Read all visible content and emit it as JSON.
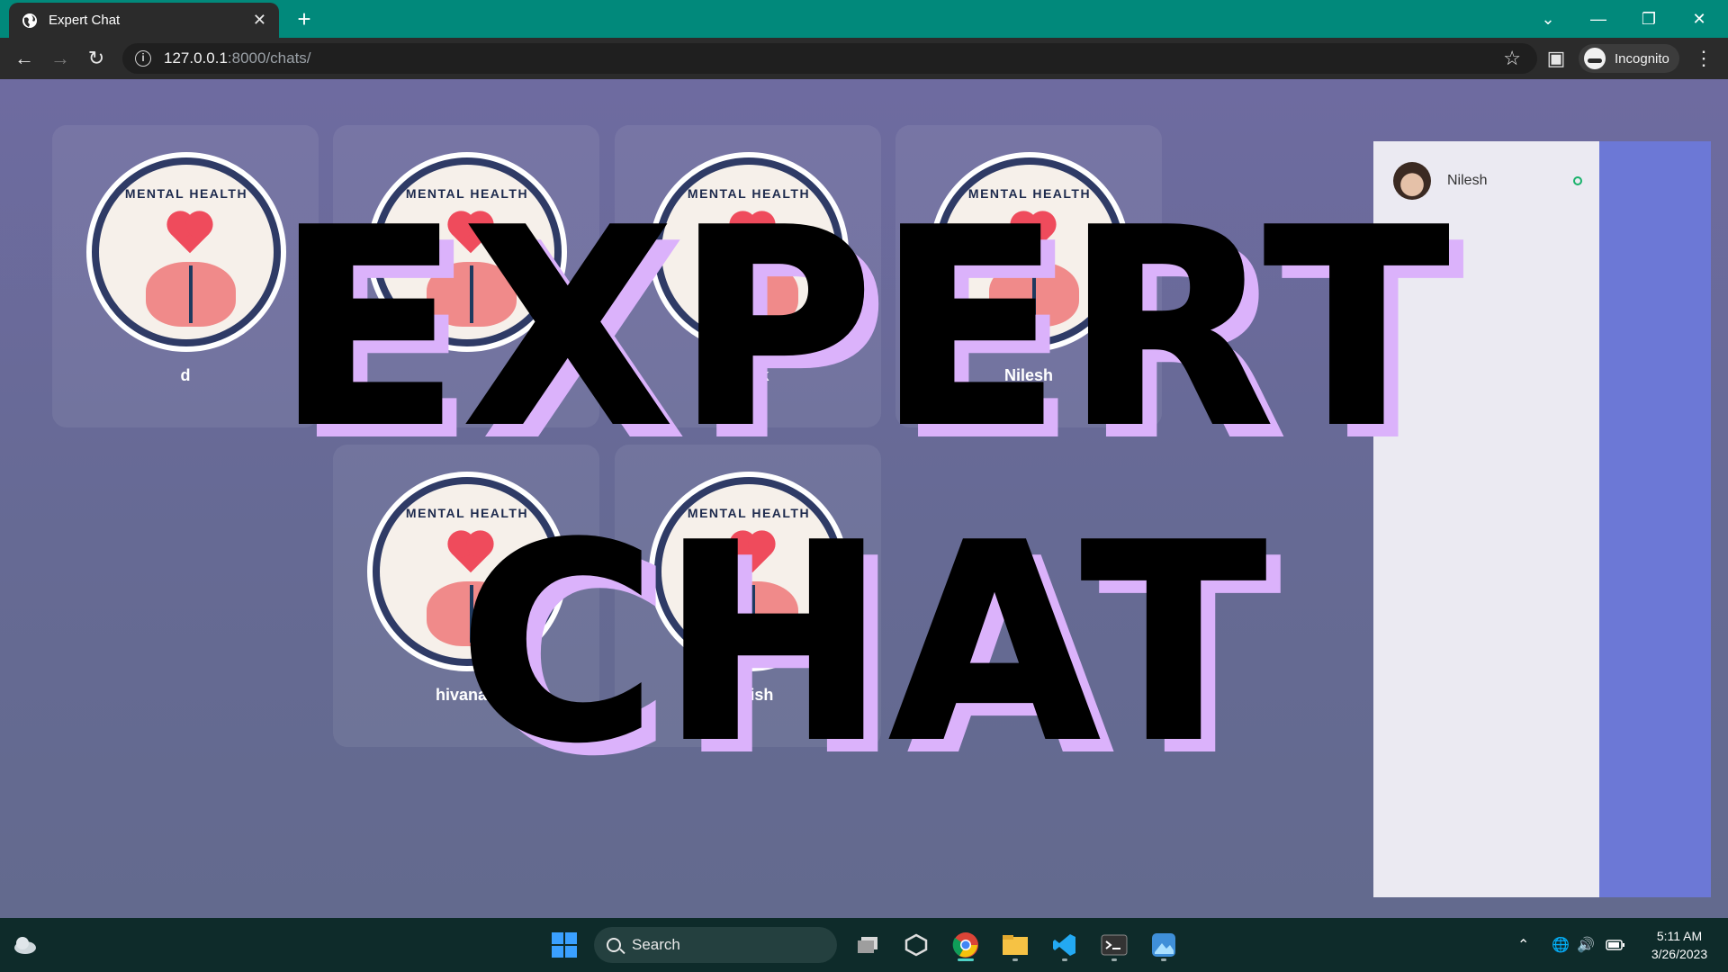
{
  "browser": {
    "tab_title": "Expert Chat",
    "url_host": "127.0.0.1",
    "url_path": ":8000/chats/",
    "profile_label": "Incognito"
  },
  "page": {
    "title_line1": "EXPERT",
    "title_line2": "CHAT",
    "cards": [
      {
        "badge_text": "MENTAL HEALTH",
        "name": "d"
      },
      {
        "badge_text": "MENTAL HEALTH",
        "name": ""
      },
      {
        "badge_text": "MENTAL HEALTH",
        "name": "Vivek"
      },
      {
        "badge_text": "MENTAL HEALTH",
        "name": "Nilesh"
      },
      {
        "badge_text": "MENTAL HEALTH",
        "name": "hivanan"
      },
      {
        "badge_text": "MENTAL HEALTH",
        "name": "Tanish"
      }
    ],
    "sidebar": {
      "contact_name": "Nilesh",
      "status_color": "#19b26b"
    }
  },
  "taskbar": {
    "search_label": "Search",
    "time": "5:11 AM",
    "date": "3/26/2023"
  },
  "colors": {
    "tabstrip": "#01897b",
    "title_shadow": "#dbb2fb",
    "sidebar_accent": "#6c78d6"
  }
}
